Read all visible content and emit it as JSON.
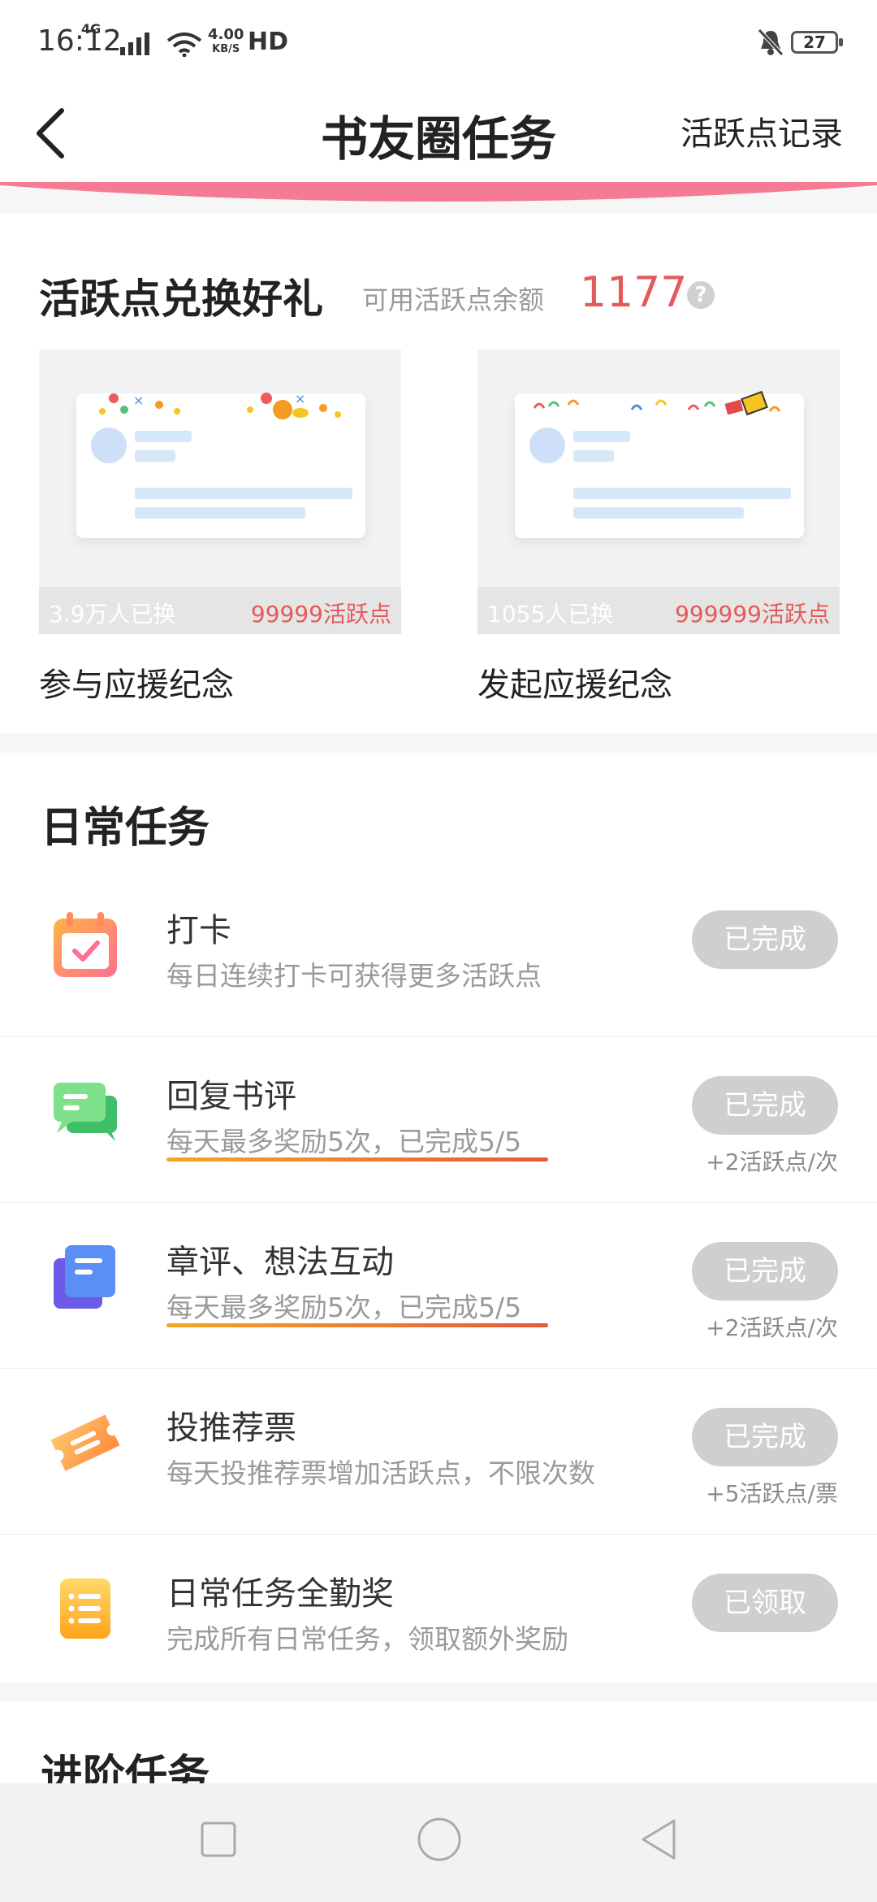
{
  "status_bar": {
    "time": "16:12",
    "network": "4G",
    "speed_value": "4.00",
    "speed_unit": "KB/S",
    "hd": "HD",
    "battery": "27"
  },
  "nav": {
    "title": "书友圈任务",
    "right_link": "活跃点记录"
  },
  "exchange": {
    "title": "活跃点兑换好礼",
    "balance_label": "可用活跃点余额",
    "balance_value": "1177",
    "items": [
      {
        "count": "3.9万人已换",
        "price": "99999活跃点",
        "name": "参与应援纪念"
      },
      {
        "count": "1055人已换",
        "price": "999999活跃点",
        "name": "发起应援纪念"
      }
    ]
  },
  "daily": {
    "title": "日常任务",
    "tasks": [
      {
        "name": "打卡",
        "desc": "每日连续打卡可获得更多活跃点",
        "button": "已完成",
        "reward": ""
      },
      {
        "name": "回复书评",
        "desc": "每天最多奖励5次，已完成5/5",
        "button": "已完成",
        "reward": "+2活跃点/次"
      },
      {
        "name": "章评、想法互动",
        "desc": "每天最多奖励5次，已完成5/5",
        "button": "已完成",
        "reward": "+2活跃点/次"
      },
      {
        "name": "投推荐票",
        "desc": "每天投推荐票增加活跃点，不限次数",
        "button": "已完成",
        "reward": "+5活跃点/票"
      },
      {
        "name": "日常任务全勤奖",
        "desc": "完成所有日常任务，领取额外奖励",
        "button": "已领取",
        "reward": ""
      }
    ]
  },
  "advanced": {
    "title": "进阶任务"
  },
  "colors": {
    "accent_red": "#e45a5a",
    "pink_strip": "#f57a93",
    "button_gray": "#cfcfcf"
  },
  "icons": [
    "back-arrow-icon",
    "calendar-check-icon",
    "chat-bubbles-icon",
    "document-stack-icon",
    "ticket-icon",
    "list-icon",
    "help-icon"
  ]
}
